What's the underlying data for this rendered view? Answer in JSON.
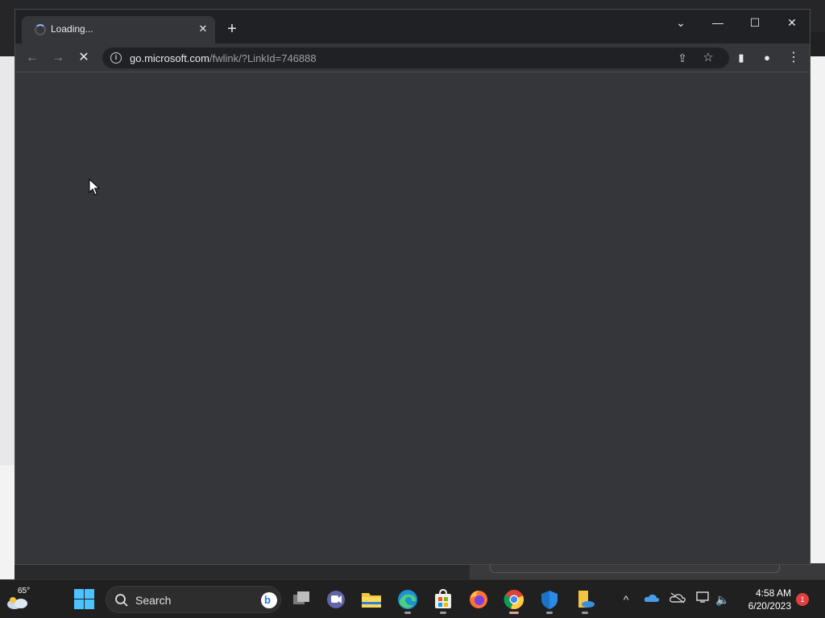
{
  "browser": {
    "tab": {
      "title": "Loading...",
      "close_glyph": "✕"
    },
    "new_tab_glyph": "+",
    "window_controls": {
      "dropdown_glyph": "⌄",
      "minimize_glyph": "—",
      "maximize_glyph": "☐",
      "close_glyph": "✕"
    },
    "toolbar": {
      "back_glyph": "←",
      "forward_glyph": "→",
      "stop_glyph": "✕",
      "url_host": "go.microsoft.com",
      "url_path": "/fwlink/?LinkId=746888",
      "info_glyph": "i",
      "share_glyph": "⇪",
      "bookmark_glyph": "☆",
      "side_panel_glyph": "▮",
      "profile_glyph": "●",
      "menu_glyph": "⋮"
    }
  },
  "taskbar": {
    "weather_temp": "65°",
    "search_label": "Search",
    "bing_glyph": "b",
    "tray": {
      "chevron_glyph": "^",
      "volume_glyph": "🔈"
    },
    "clock": {
      "time": "4:58 AM",
      "date": "6/20/2023"
    },
    "notification_count": "1"
  },
  "colors": {
    "accent": "#4cc2ff",
    "browser_bg": "#35363a",
    "titlebar_bg": "#202124"
  }
}
